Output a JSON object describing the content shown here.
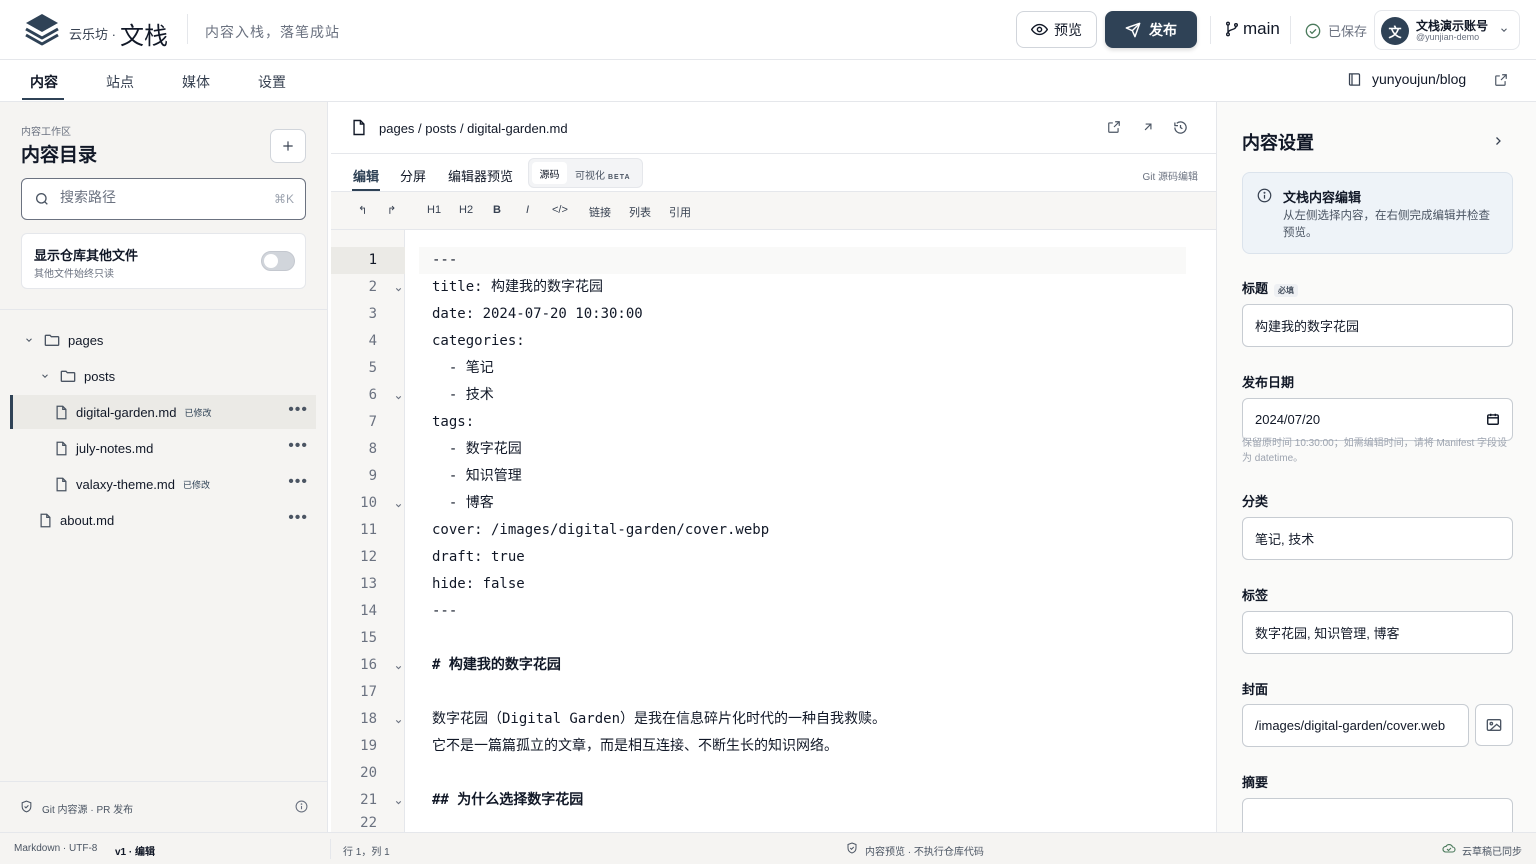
{
  "app": {
    "brand_sub": "云乐坊 ·",
    "brand_main": "文栈",
    "tagline": "内容入栈，落笔成站"
  },
  "header": {
    "preview_label": "预览",
    "publish_label": "发布",
    "branch": "main",
    "save_status": "已保存",
    "account_initial": "文",
    "account_name": "文栈演示账号",
    "account_handle": "@yunjian-demo"
  },
  "nav": {
    "tabs": [
      {
        "label": "内容",
        "active": true
      },
      {
        "label": "站点",
        "active": false
      },
      {
        "label": "媒体",
        "active": false
      },
      {
        "label": "设置",
        "active": false
      }
    ],
    "repo": "yunyoujun/blog"
  },
  "sidebar": {
    "kicker": "内容工作区",
    "title": "内容目录",
    "search_placeholder": "搜索路径",
    "search_shortcut": "⌘K",
    "toggle_title": "显示仓库其他文件",
    "toggle_subtitle": "其他文件始终只读",
    "toggle_on": false,
    "tree": [
      {
        "label": "pages",
        "type": "folder"
      },
      {
        "label": "posts",
        "type": "folder"
      },
      {
        "label": "digital-garden.md",
        "type": "file",
        "badge": "已修改",
        "selected": true
      },
      {
        "label": "july-notes.md",
        "type": "file"
      },
      {
        "label": "valaxy-theme.md",
        "type": "file",
        "badge": "已修改"
      },
      {
        "label": "about.md",
        "type": "file"
      }
    ],
    "footer": "Git 内容源 · PR 发布"
  },
  "editor": {
    "path": "pages / posts / digital-garden.md",
    "tabs": [
      "编辑",
      "分屏",
      "编辑器预览"
    ],
    "mode_source": "源码",
    "mode_visual": "可视化",
    "mode_beta": "BETA",
    "git_label": "Git 源码编辑",
    "toolbar": [
      "↰",
      "↱",
      "H1",
      "H2",
      "B",
      "I",
      "</>",
      "链接",
      "列表",
      "引用"
    ],
    "lines": [
      "---",
      "title: 构建我的数字花园",
      "date: 2024-07-20 10:30:00",
      "categories:",
      "  - 笔记",
      "  - 技术",
      "tags:",
      "  - 数字花园",
      "  - 知识管理",
      "  - 博客",
      "cover: /images/digital-garden/cover.webp",
      "draft: true",
      "hide: false",
      "---",
      "",
      "# 构建我的数字花园",
      "",
      "数字花园（Digital Garden）是我在信息碎片化时代的一种自我救赎。",
      "它不是一篇篇孤立的文章，而是相互连接、不断生长的知识网络。",
      "",
      "## 为什么选择数字花园",
      ""
    ]
  },
  "settings": {
    "title": "内容设置",
    "info_title": "文栈内容编辑",
    "info_desc": "从左侧选择内容，在右侧完成编辑并检查预览。",
    "title_label": "标题",
    "required": "必填",
    "title_value": "构建我的数字花园",
    "date_label": "发布日期",
    "date_value": "2024/07/20",
    "date_hint": "保留原时间 10:30:00；如需编辑时间，请将 Manifest 字段设为 datetime。",
    "category_label": "分类",
    "category_value": "笔记, 技术",
    "tags_label": "标签",
    "tags_value": "数字花园, 知识管理, 博客",
    "cover_label": "封面",
    "cover_value": "/images/digital-garden/cover.web",
    "summary_label": "摘要",
    "summary_value": ""
  },
  "status": {
    "encoding": "Markdown · UTF-8",
    "mode": "v1 · 编辑",
    "cursor": "行 1，列 1",
    "preview_note": "内容预览 · 不执行仓库代码",
    "sync": "云草稿已同步"
  }
}
